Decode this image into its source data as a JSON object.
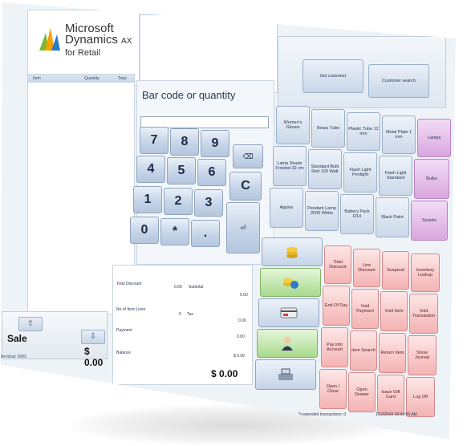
{
  "logo": {
    "line1": "Microsoft",
    "line2": "Dynamics",
    "line2_suffix": "AX",
    "line3": "for Retail"
  },
  "receipt": {
    "columns": [
      "Item",
      "Quantity",
      "Total"
    ]
  },
  "sale": {
    "label": "Sale",
    "total": "$ 0.00",
    "up_icon": "⇧",
    "down_icon": "⇩"
  },
  "terminal": "Terminal: 0002",
  "barcode": {
    "label": "Bar code or quantity",
    "value": ""
  },
  "keypad": {
    "keys": [
      "7",
      "8",
      "9",
      "4",
      "5",
      "6",
      "1",
      "2",
      "3",
      "0",
      "*",
      "."
    ],
    "backspace_icon": "⌫",
    "clear_label": "C",
    "enter_icon": "⏎"
  },
  "totals": {
    "total_discount_label": "Total Discount",
    "total_discount_value": "0.00",
    "subtotal_label": "Subtotal",
    "subtotal_value": "0.00",
    "item_lines_label": "No of Item Lines",
    "item_lines_value": "0",
    "tax_label": "Tax",
    "tax_value": "0.00",
    "payment_label": "Payment",
    "payment_value": "0.00",
    "balance_label": "Balance",
    "balance_value": "$ 0.00",
    "grand_total": "$ 0.00"
  },
  "customer": {
    "get_label": "Get customer",
    "search_label": "Customer search"
  },
  "products": [
    {
      "label": "Women's Gloves",
      "color": "blue"
    },
    {
      "label": "Brass Tube",
      "color": "blue"
    },
    {
      "label": "Plastic Tube 12 mm",
      "color": "blue"
    },
    {
      "label": "Metal Plate 1 mm",
      "color": "blue"
    },
    {
      "label": "Lamps",
      "color": "purple"
    },
    {
      "label": "Lamp Shade Frosted 32 cm",
      "color": "blue"
    },
    {
      "label": "Standard Bulb Red 100 Watt",
      "color": "blue"
    },
    {
      "label": "Flash Light Penlight",
      "color": "blue"
    },
    {
      "label": "Flash Light Standard",
      "color": "blue"
    },
    {
      "label": "Bulbs",
      "color": "purple"
    },
    {
      "label": "Apples",
      "color": "blue"
    },
    {
      "label": "Pendant Lamp 2500 White",
      "color": "blue"
    },
    {
      "label": "Battery Pack R14",
      "color": "blue"
    },
    {
      "label": "Black Paint",
      "color": "blue"
    },
    {
      "label": "Snacks",
      "color": "purple"
    }
  ],
  "operations": [
    "Total Discount",
    "Line Discount",
    "Suspend",
    "Inventory Lookup",
    "End Of Day",
    "Void Payment",
    "Void Item",
    "Void Transaction",
    "Pay into Account",
    "Item Search",
    "Return Item",
    "Show Journal",
    "Open / Close",
    "Open Drawer",
    "Issue Gift Card",
    "Log Off"
  ],
  "icons": [
    "coins-icon",
    "globe-coins-icon",
    "credit-card-icon",
    "person-icon",
    "cash-register-icon"
  ],
  "status": {
    "suspended": "Suspended transactions: 0",
    "datetime": "1/12/2010 10:04:06 AM"
  }
}
